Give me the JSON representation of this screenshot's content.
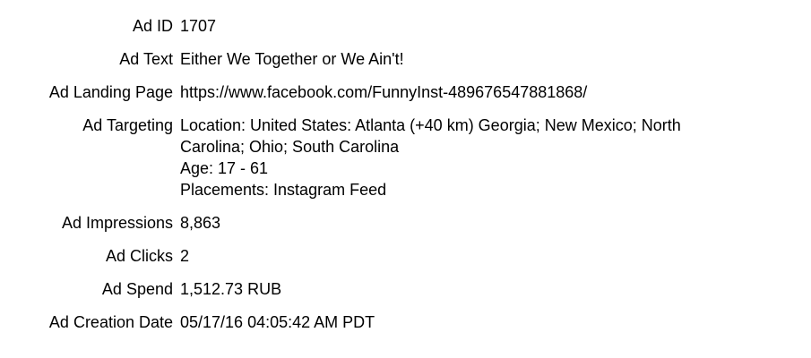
{
  "ad_record": {
    "fields": [
      {
        "label": "Ad ID",
        "lines": [
          "1707"
        ]
      },
      {
        "label": "Ad Text",
        "lines": [
          "Either We Together or We Ain't!"
        ]
      },
      {
        "label": "Ad Landing Page",
        "lines": [
          "https://www.facebook.com/FunnyInst-489676547881868/"
        ]
      },
      {
        "label": "Ad Targeting",
        "lines": [
          "Location: United States: Atlanta (+40 km) Georgia; New Mexico; North",
          "Carolina; Ohio; South Carolina",
          "Age: 17 - 61",
          "Placements: Instagram Feed"
        ]
      },
      {
        "label": "Ad Impressions",
        "lines": [
          "8,863"
        ]
      },
      {
        "label": "Ad Clicks",
        "lines": [
          "2"
        ]
      },
      {
        "label": "Ad Spend",
        "lines": [
          "1,512.73 RUB"
        ]
      },
      {
        "label": "Ad Creation Date",
        "lines": [
          "05/17/16 04:05:42 AM PDT"
        ]
      }
    ]
  }
}
